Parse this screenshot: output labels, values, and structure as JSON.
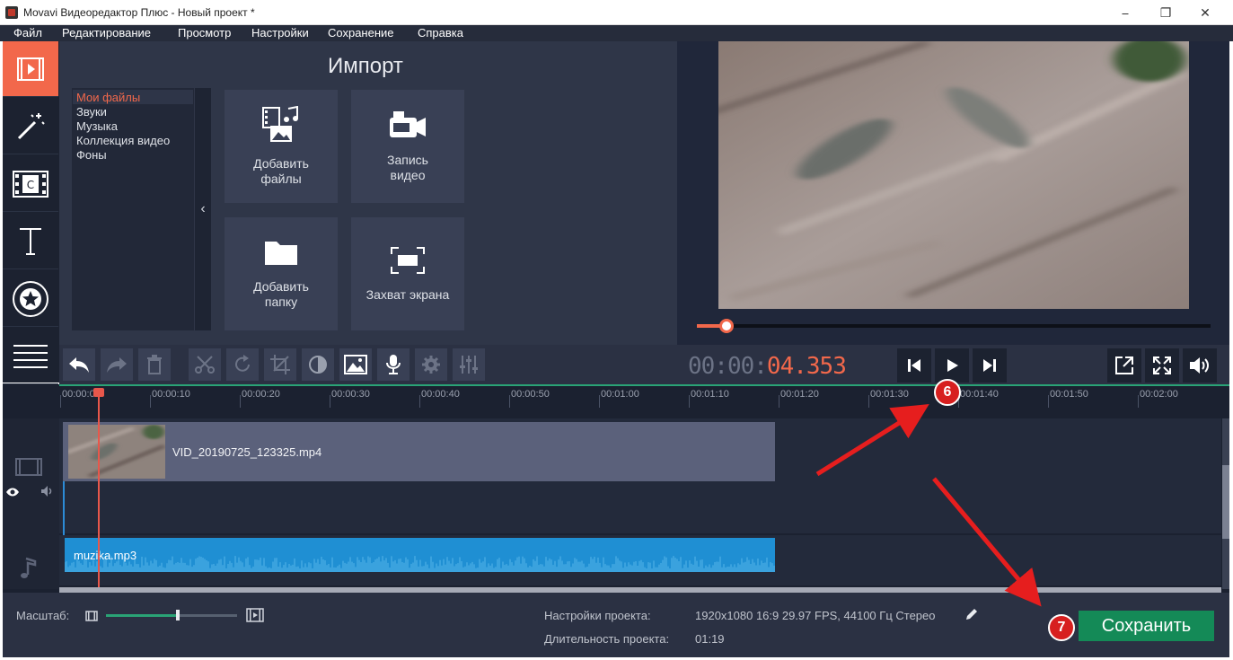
{
  "window": {
    "title": "Movavi Видеоредактор Плюс - Новый проект *",
    "minimize_glyph": "⎯",
    "maximize_glyph": "❐",
    "close_glyph": "✕"
  },
  "menu": [
    "Файл",
    "Редактирование",
    "Просмотр",
    "Настройки",
    "Сохранение",
    "Справка"
  ],
  "left_toolbar": [
    "import-icon",
    "magic-wand-icon",
    "transitions-icon",
    "titles-icon",
    "stickers-icon",
    "more-icon"
  ],
  "import": {
    "title": "Импорт",
    "categories": [
      "Мои файлы",
      "Звуки",
      "Музыка",
      "Коллекция видео",
      "Фоны"
    ],
    "tiles": [
      {
        "label_line1": "Добавить",
        "label_line2": "файлы"
      },
      {
        "label_line1": "Запись",
        "label_line2": "видео"
      },
      {
        "label_line1": "Добавить",
        "label_line2": "папку"
      },
      {
        "label_line1": "Захват экрана",
        "label_line2": ""
      }
    ]
  },
  "player": {
    "timecode_dim": "00:00:",
    "timecode_active": "04.353",
    "progress_fraction": 0.055
  },
  "timeline": {
    "ruler": [
      "00:00:00",
      "00:00:10",
      "00:00:20",
      "00:00:30",
      "00:00:40",
      "00:00:50",
      "00:01:00",
      "00:01:10",
      "00:01:20",
      "00:01:30",
      "00:01:40",
      "00:01:50",
      "00:02:00"
    ],
    "video_clip": "VID_20190725_123325.mp4",
    "audio_clip": "muzika.mp3"
  },
  "bottom": {
    "zoom_label": "Масштаб:",
    "zoom_fraction": 0.55,
    "settings_label": "Настройки проекта:",
    "settings_value": "1920x1080 16:9 29.97 FPS, 44100 Гц Стерео",
    "duration_label": "Длительность проекта:",
    "duration_value": "01:19",
    "save_label": "Сохранить"
  },
  "annotations": {
    "marker6": "6",
    "marker7": "7"
  },
  "colors": {
    "accent": "#f2684b",
    "save": "#148a57",
    "audio": "#1f8fd3",
    "arrow": "#e61e1e"
  }
}
